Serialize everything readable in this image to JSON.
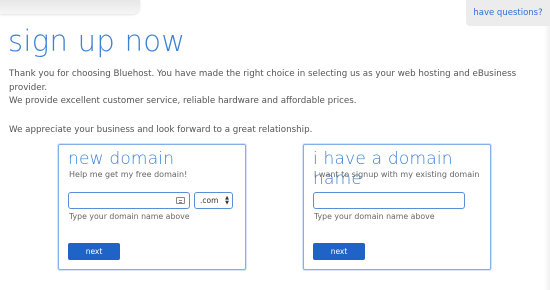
{
  "header": {
    "help_tab_label": "have questions?"
  },
  "page": {
    "title": "sign up now",
    "intro_line_1": "Thank you for choosing Bluehost. You have made the right choice in selecting us as your web hosting and eBusiness provider.",
    "intro_line_2": "We provide excellent customer service, reliable hardware and affordable prices.",
    "intro_line_3": "We appreciate your business and look forward to a great relationship."
  },
  "new_domain": {
    "title": "new domain",
    "subtitle": "Help me get my free domain!",
    "input_value": "",
    "tld_selected": ".com",
    "hint": "Type your domain name above",
    "next_label": "next"
  },
  "existing_domain": {
    "title": "i have a domain name",
    "subtitle": "I want to signup with my existing domain",
    "input_value": "",
    "hint": "Type your domain name above",
    "next_label": "next"
  },
  "colors": {
    "accent": "#3b81d6",
    "button": "#1f63c6",
    "border": "#86aeea"
  }
}
